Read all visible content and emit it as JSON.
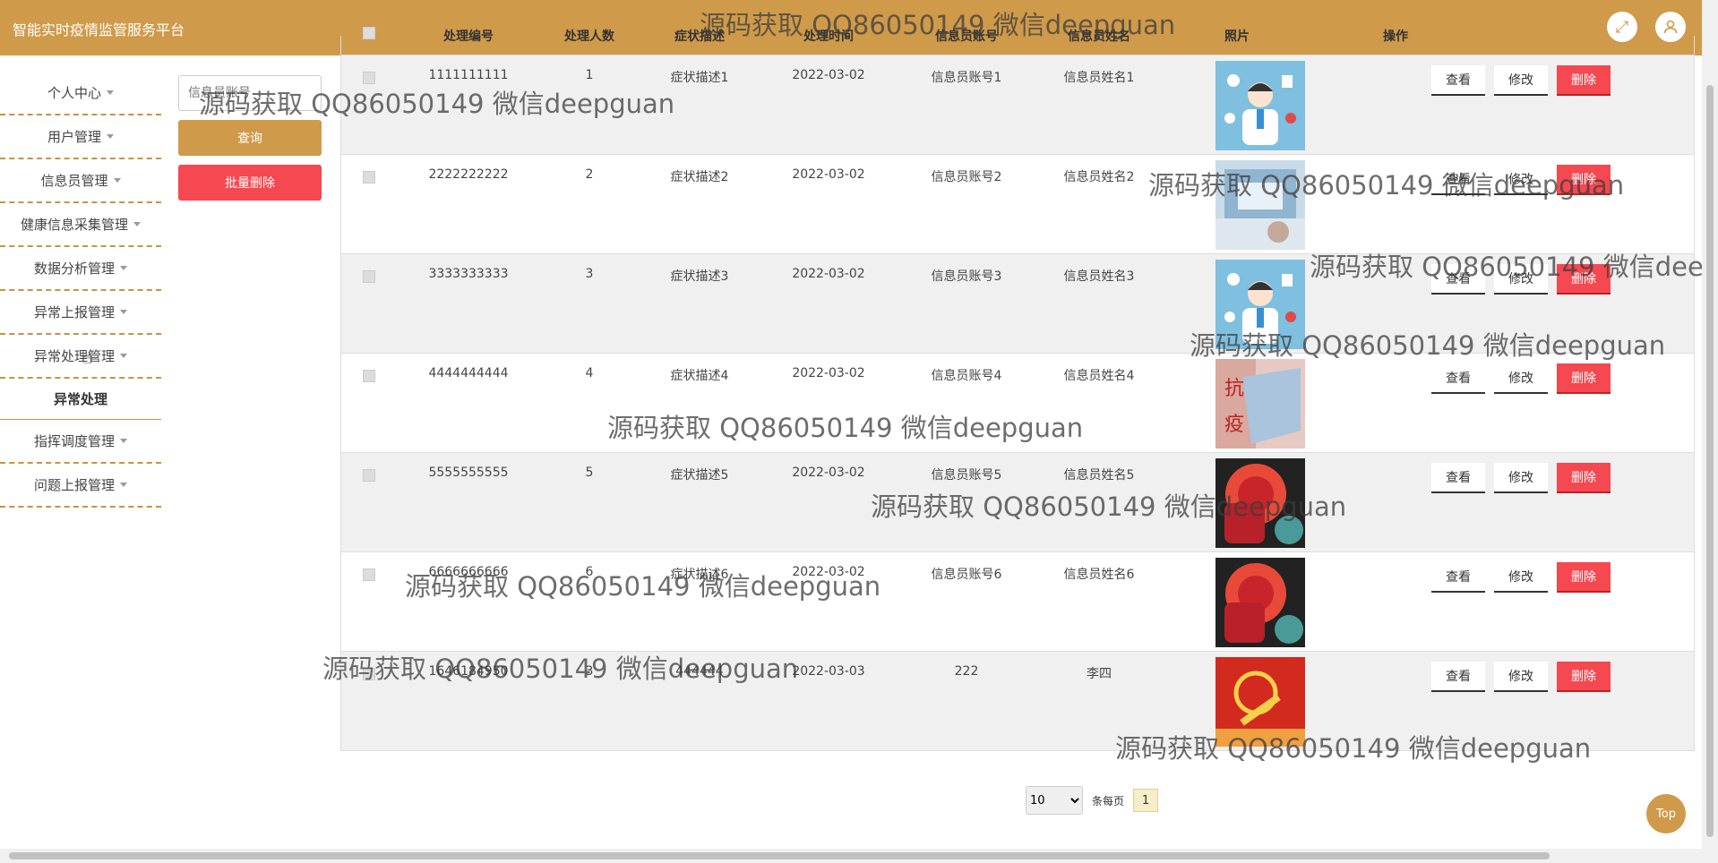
{
  "header": {
    "title": "智能实时疫情监管服务平台",
    "watermark": "源码获取 QQ86050149 微信deepguan"
  },
  "sidebar": {
    "items": [
      {
        "label": "个人中心",
        "caret": true
      },
      {
        "label": "用户管理",
        "caret": true
      },
      {
        "label": "信息员管理",
        "caret": true
      },
      {
        "label": "健康信息采集管理",
        "caret": true
      },
      {
        "label": "数据分析管理",
        "caret": true
      },
      {
        "label": "异常上报管理",
        "caret": true
      },
      {
        "label": "异常处理管理",
        "caret": true
      },
      {
        "label": "异常处理",
        "caret": false
      },
      {
        "label": "指挥调度管理",
        "caret": true
      },
      {
        "label": "问题上报管理",
        "caret": true
      }
    ]
  },
  "controls": {
    "search_placeholder": "信息员账号",
    "query_label": "查询",
    "batch_delete_label": "批量删除"
  },
  "table": {
    "headers": [
      "处理编号",
      "处理人数",
      "症状描述",
      "处理时间",
      "信息员账号",
      "信息员姓名",
      "照片",
      "操作"
    ],
    "rows": [
      {
        "id": "1111111111",
        "count": "1",
        "desc": "症状描述1",
        "date": "2022-03-02",
        "account": "信息员账号1",
        "name": "信息员姓名1",
        "img": "doctor"
      },
      {
        "id": "2222222222",
        "count": "2",
        "desc": "症状描述2",
        "date": "2022-03-02",
        "account": "信息员账号2",
        "name": "信息员姓名2",
        "img": "lab"
      },
      {
        "id": "3333333333",
        "count": "3",
        "desc": "症状描述3",
        "date": "2022-03-02",
        "account": "信息员账号3",
        "name": "信息员姓名3",
        "img": "doctor"
      },
      {
        "id": "4444444444",
        "count": "4",
        "desc": "症状描述4",
        "date": "2022-03-02",
        "account": "信息员账号4",
        "name": "信息员姓名4",
        "img": "mask"
      },
      {
        "id": "5555555555",
        "count": "5",
        "desc": "症状描述5",
        "date": "2022-03-02",
        "account": "信息员账号5",
        "name": "信息员姓名5",
        "img": "fist"
      },
      {
        "id": "6666666666",
        "count": "6",
        "desc": "症状描述6",
        "date": "2022-03-02",
        "account": "信息员账号6",
        "name": "信息员姓名6",
        "img": "fist"
      },
      {
        "id": "1646184950",
        "count": "3",
        "desc": "444444",
        "date": "2022-03-03",
        "account": "222",
        "name": "李四",
        "img": "flag"
      }
    ],
    "actions": {
      "view": "查看",
      "edit": "修改",
      "delete": "删除"
    }
  },
  "pager": {
    "page_size": "10",
    "per_page_label": "条每页",
    "current_page": "1"
  },
  "top_button": "Top",
  "colors": {
    "brand": "#cf9a4a",
    "danger": "#f54850"
  }
}
